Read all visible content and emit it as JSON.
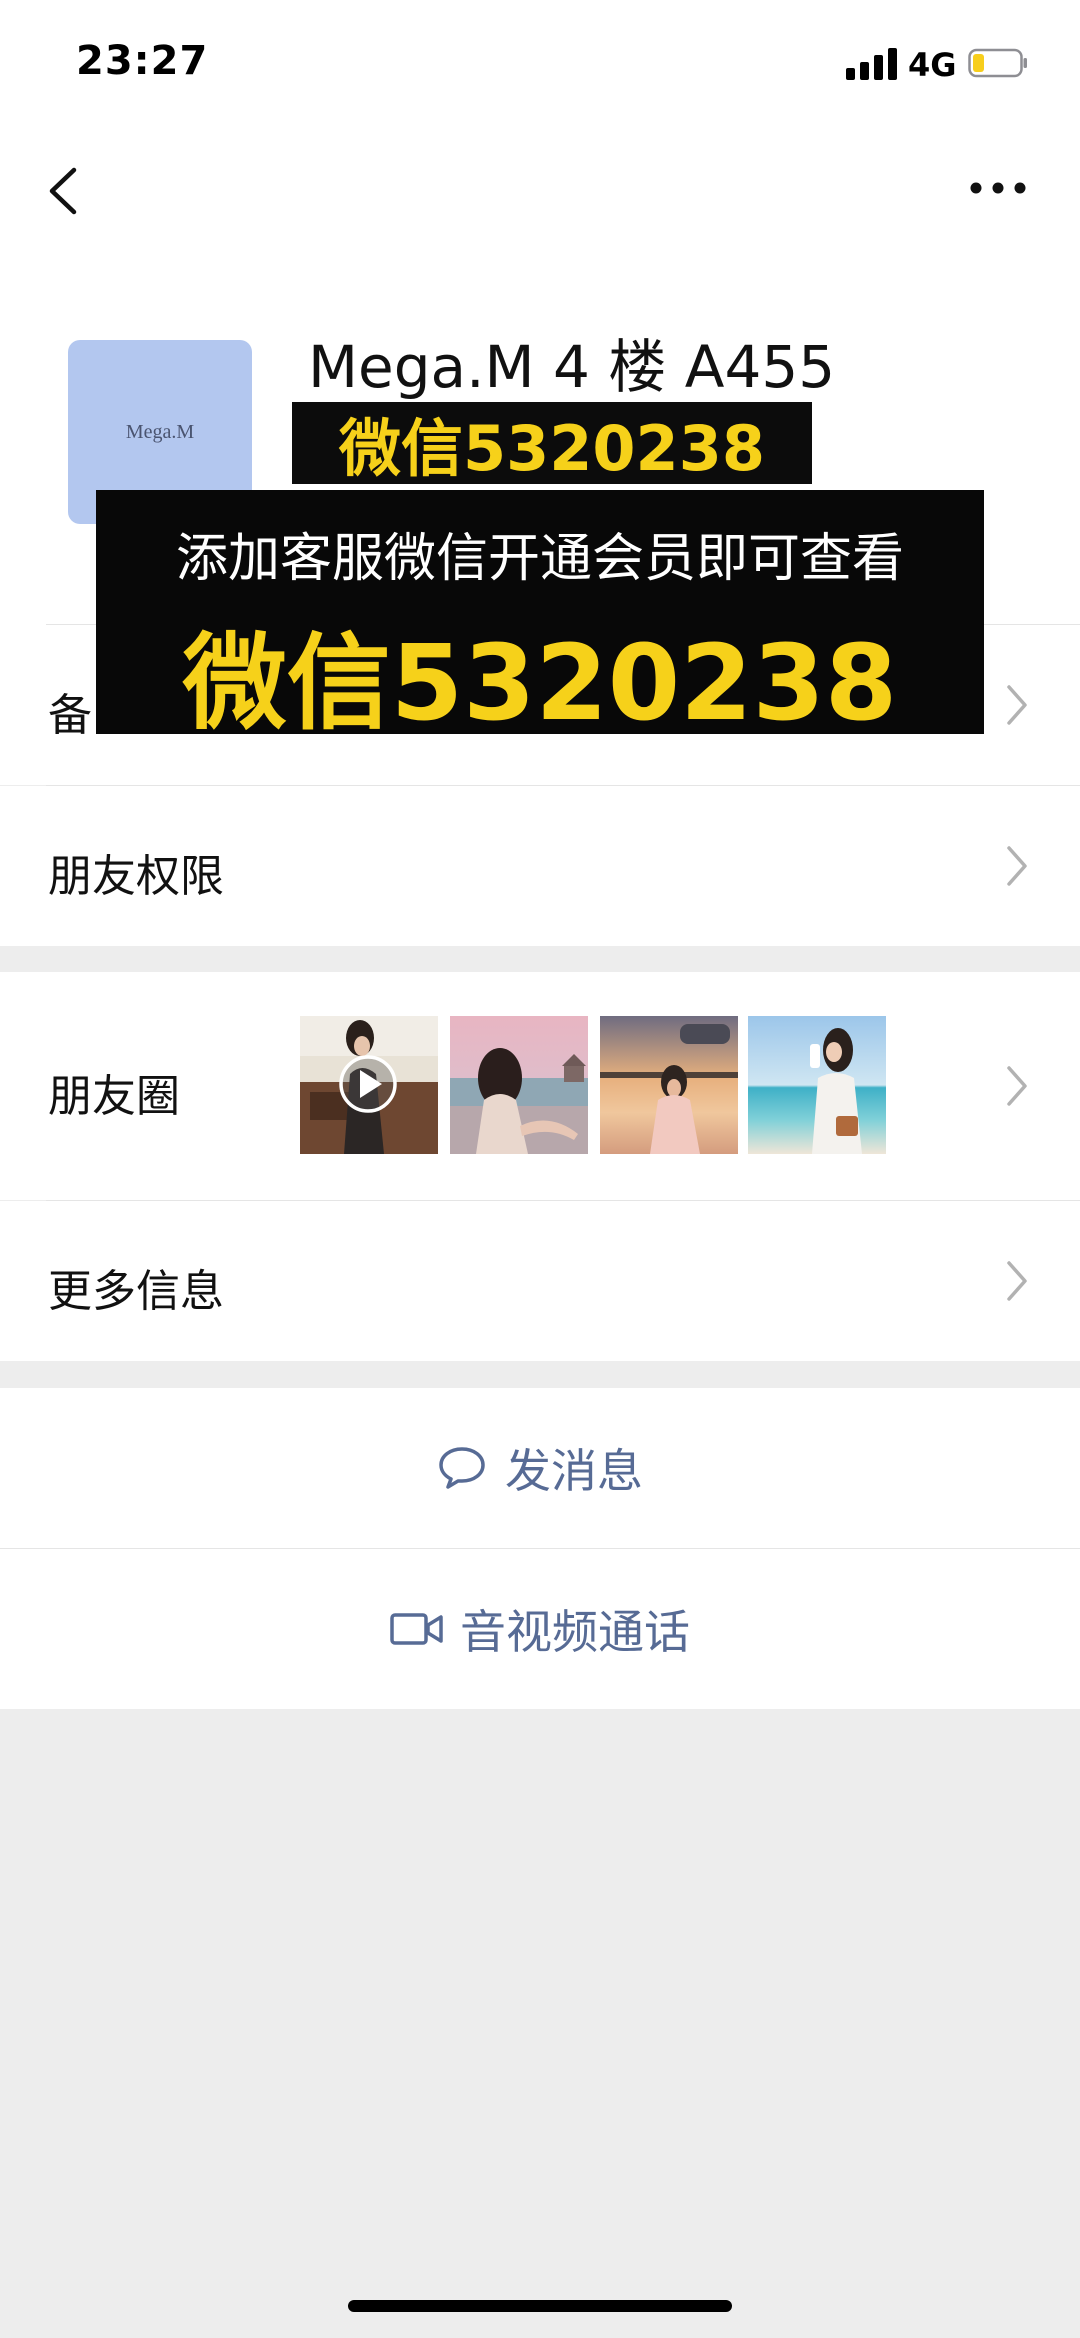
{
  "status_bar": {
    "time": "23:27",
    "network": "4G"
  },
  "profile": {
    "avatar_text": "Mega.M",
    "name": "Mega.M 4 楼 A455"
  },
  "overlay": {
    "small_banner": "微信5320238",
    "big_line1": "添加客服微信开通会员即可查看",
    "big_line2": "微信5320238"
  },
  "rows": {
    "remark_label": "备",
    "permissions_label": "朋友权限",
    "moments_label": "朋友圈",
    "more_info_label": "更多信息"
  },
  "actions": {
    "send_message": "发消息",
    "av_call": "音视频通话"
  },
  "colors": {
    "link_blue": "#576b95",
    "banner_yellow": "#f6d11a",
    "page_bg": "#ededed",
    "avatar_bg": "#b3c7ef"
  }
}
